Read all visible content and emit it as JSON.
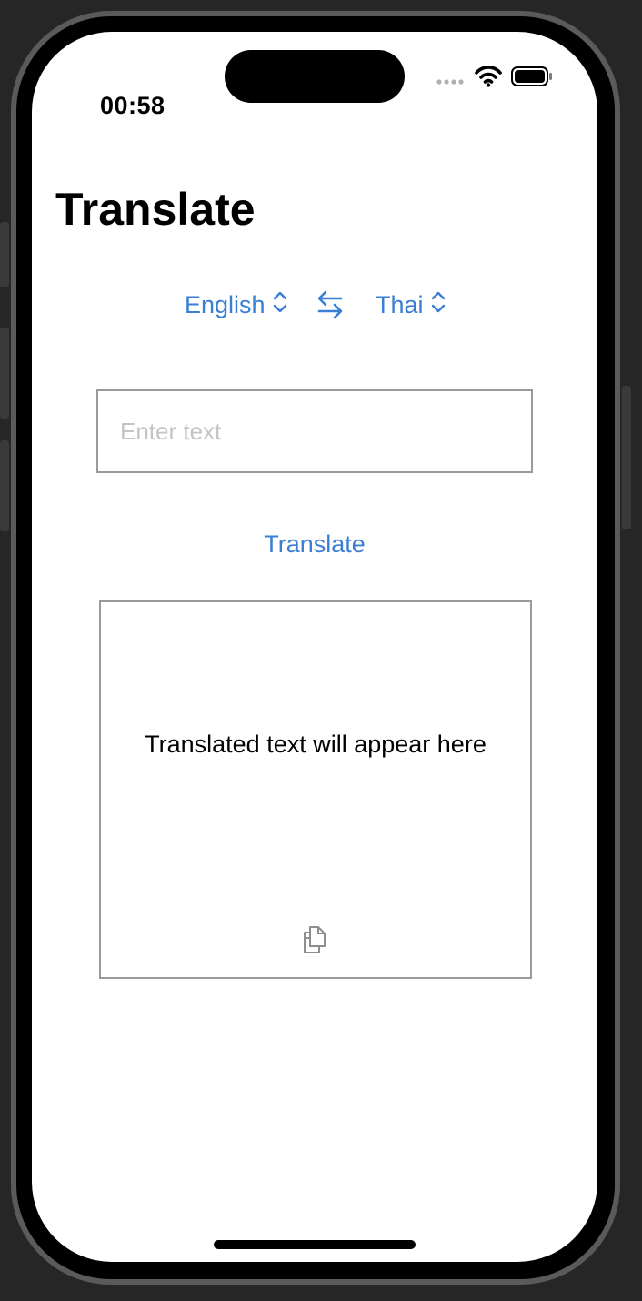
{
  "status_bar": {
    "time": "00:58",
    "signal_icon": "signal-dots-icon",
    "wifi_icon": "wifi-icon",
    "battery_icon": "battery-icon"
  },
  "header": {
    "title": "Translate"
  },
  "language_bar": {
    "source_language": "English",
    "target_language": "Thai",
    "swap_icon": "swap-arrows-icon",
    "chevron_icon": "chevron-up-down-icon"
  },
  "input": {
    "value": "",
    "placeholder": "Enter text"
  },
  "actions": {
    "translate_label": "Translate"
  },
  "output": {
    "placeholder_text": "Translated text will appear here",
    "copy_icon": "copy-documents-icon"
  },
  "colors": {
    "accent": "#3a7fd5",
    "placeholder": "#c4c4c6",
    "border": "#9a9a9a",
    "background": "#ffffff"
  }
}
